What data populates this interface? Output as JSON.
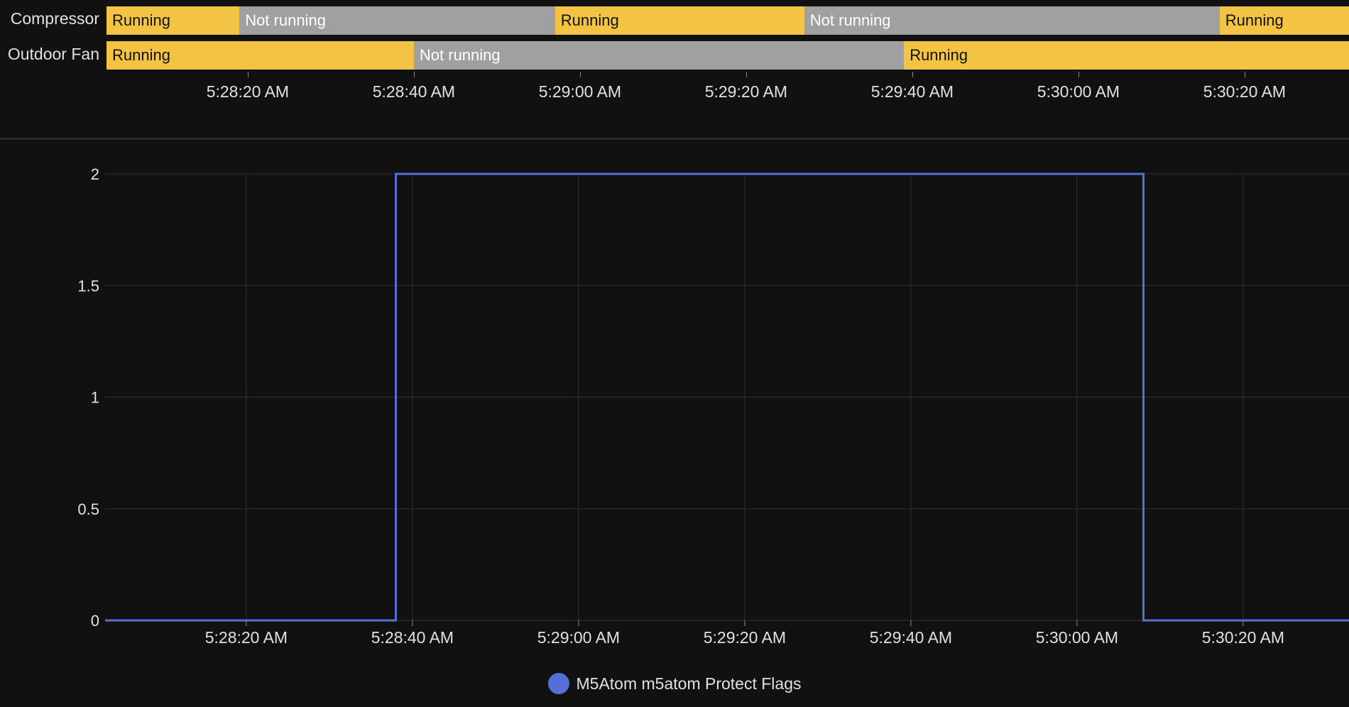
{
  "colors": {
    "running": "#f3c443",
    "not_running": "#a0a0a0",
    "series": "#5470d6",
    "grid": "#333333",
    "text": "#e1e1e1"
  },
  "timeline": {
    "rows": [
      {
        "label": "Compressor",
        "segments": [
          {
            "state": "Running",
            "start": "5:28:03 AM",
            "end": "5:28:19 AM"
          },
          {
            "state": "Not running",
            "start": "5:28:19 AM",
            "end": "5:28:57 AM"
          },
          {
            "state": "Running",
            "start": "5:28:57 AM",
            "end": "5:29:27 AM"
          },
          {
            "state": "Not running",
            "start": "5:29:27 AM",
            "end": "5:30:17 AM"
          },
          {
            "state": "Running",
            "start": "5:30:17 AM",
            "end": "5:30:33 AM"
          }
        ]
      },
      {
        "label": "Outdoor Fan",
        "segments": [
          {
            "state": "Running",
            "start": "5:28:03 AM",
            "end": "5:28:40 AM"
          },
          {
            "state": "Not running",
            "start": "5:28:40 AM",
            "end": "5:29:39 AM"
          },
          {
            "state": "Running",
            "start": "5:29:39 AM",
            "end": "5:30:33 AM"
          }
        ]
      }
    ],
    "x_ticks": [
      "5:28:20 AM",
      "5:28:40 AM",
      "5:29:00 AM",
      "5:29:20 AM",
      "5:29:40 AM",
      "5:30:00 AM",
      "5:30:20 AM"
    ]
  },
  "chart_data": {
    "type": "line",
    "step": true,
    "xlabel": "",
    "ylabel": "",
    "x_ticks": [
      "5:28:20 AM",
      "5:28:40 AM",
      "5:29:00 AM",
      "5:29:20 AM",
      "5:29:40 AM",
      "5:30:00 AM",
      "5:30:20 AM"
    ],
    "y_ticks": [
      "0",
      "0.5",
      "1",
      "1.5",
      "2"
    ],
    "ylim": [
      0,
      2
    ],
    "grid": true,
    "legend_position": "bottom-center",
    "series": [
      {
        "name": "M5Atom m5atom Protect Flags",
        "x": [
          "5:28:03 AM",
          "5:28:38 AM",
          "5:30:08 AM",
          "5:30:33 AM"
        ],
        "values": [
          0,
          2,
          0,
          0
        ]
      }
    ]
  }
}
